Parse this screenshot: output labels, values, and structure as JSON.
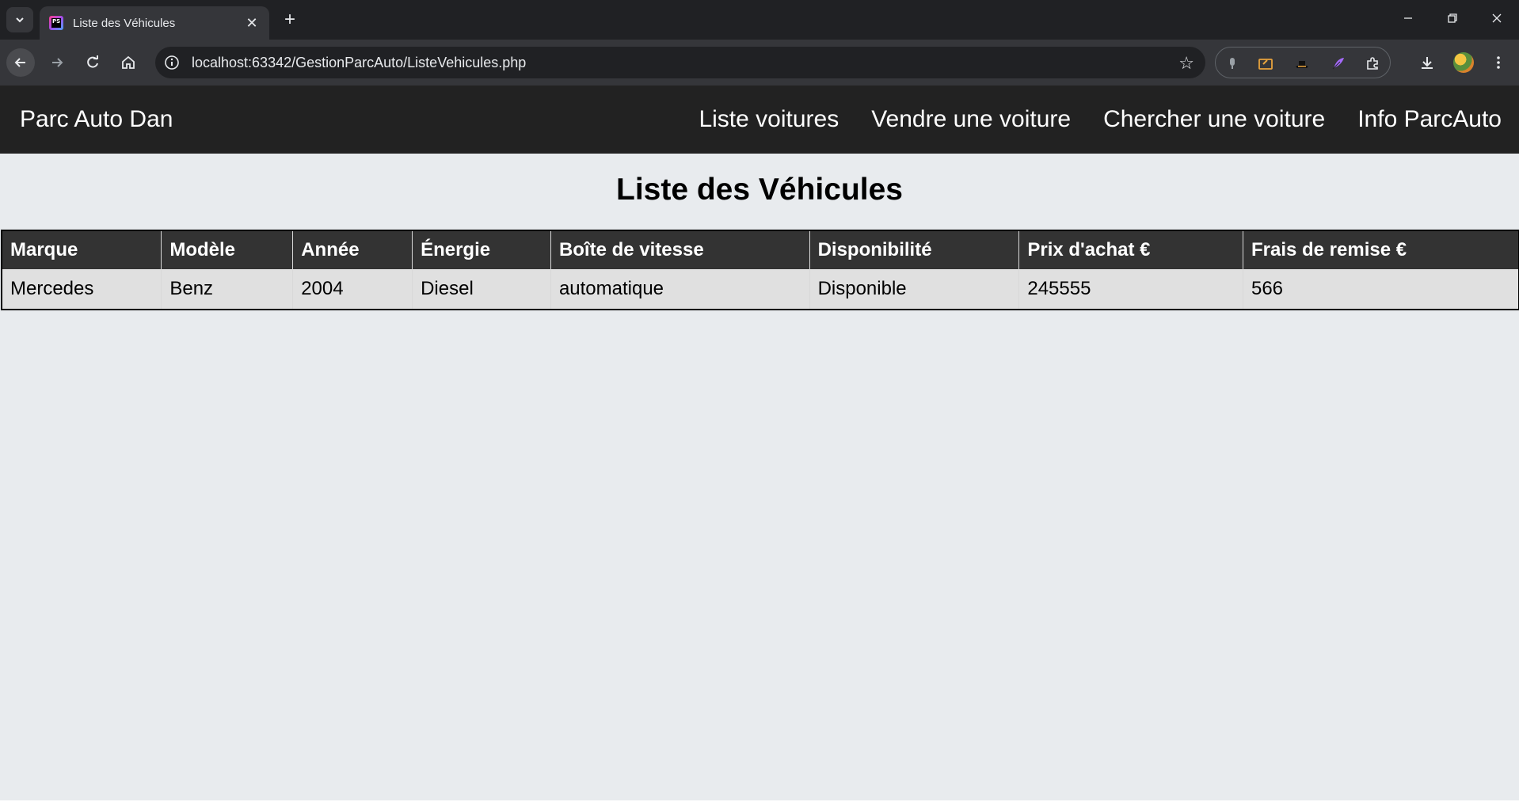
{
  "browser": {
    "tab_title": "Liste des Véhicules",
    "favicon_text": "PS",
    "url": "localhost:63342/GestionParcAuto/ListeVehicules.php"
  },
  "site": {
    "brand": "Parc Auto Dan",
    "nav": [
      {
        "label": "Liste voitures"
      },
      {
        "label": "Vendre une voiture"
      },
      {
        "label": "Chercher une voiture"
      },
      {
        "label": "Info ParcAuto"
      }
    ]
  },
  "main": {
    "title": "Liste des Véhicules",
    "table": {
      "columns": [
        "Marque",
        "Modèle",
        "Année",
        "Énergie",
        "Boîte de vitesse",
        "Disponibilité",
        "Prix d'achat €",
        "Frais de remise €"
      ],
      "rows": [
        [
          "Mercedes",
          "Benz",
          "2004",
          "Diesel",
          "automatique",
          "Disponible",
          "245555",
          "566"
        ]
      ]
    }
  }
}
